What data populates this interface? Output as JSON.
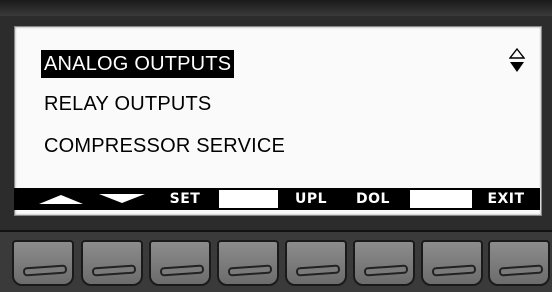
{
  "menu": {
    "items": [
      {
        "label": "ANALOG OUTPUTS",
        "selected": true
      },
      {
        "label": "RELAY OUTPUTS",
        "selected": false
      },
      {
        "label": "COMPRESSOR SERVICE",
        "selected": false
      }
    ],
    "scroll_indicator_icon": "up-down-arrows-icon"
  },
  "softkeys": {
    "k1_icon": "up-arrow-icon",
    "k2_icon": "down-arrow-icon",
    "k3_label": "SET",
    "k4_label": "",
    "k5_label": "UPL",
    "k6_label": "DOL",
    "k7_label": "",
    "k8_label": "EXIT"
  },
  "colors": {
    "screen_bg": "#fafafa",
    "selection_bg": "#000000",
    "bezel": "#2c2c2c",
    "key": "#7c7c7c"
  }
}
